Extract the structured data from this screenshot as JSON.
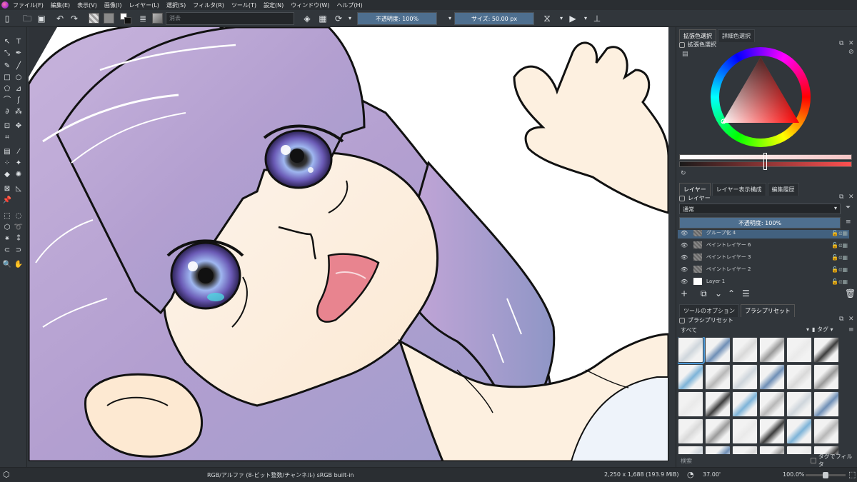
{
  "menu": [
    "ファイル(F)",
    "編集(E)",
    "表示(V)",
    "画像(I)",
    "レイヤー(L)",
    "選択(S)",
    "フィルタ(R)",
    "ツール(T)",
    "設定(N)",
    "ウィンドウ(W)",
    "ヘルプ(H)"
  ],
  "toolbar": {
    "blend_mode": "消去",
    "opacity": "不透明度: 100%",
    "opacity_value": 1.0,
    "size": "サイズ: 50.00 px",
    "size_value": 50.0
  },
  "colors": {
    "foreground": "#ffffff",
    "background": "#8a8a8a",
    "accent": "#4e6f8f",
    "selected_layer": "#42617f"
  },
  "color_docker": {
    "tabs": [
      "拡張色選択",
      "詳細色選択"
    ],
    "title": "拡張色選択"
  },
  "layers_docker": {
    "tabs": [
      "レイヤー",
      "レイヤー表示構成",
      "編集履歴"
    ],
    "title": "レイヤー",
    "blend_mode": "通常",
    "opacity": "不透明度: 100%",
    "layers": [
      {
        "name": "グループ化 4",
        "selected": true
      },
      {
        "name": "ペイントレイヤー 6",
        "selected": false
      },
      {
        "name": "ペイントレイヤー 3",
        "selected": false
      },
      {
        "name": "ペイントレイヤー 2",
        "selected": false
      },
      {
        "name": "Layer 1",
        "selected": false
      }
    ]
  },
  "brush_docker": {
    "tabs": [
      "ツールのオプション",
      "ブラシプリセット"
    ],
    "title": "ブラシプリセット",
    "filter": "すべて",
    "tag_label": "タグ",
    "search_placeholder": "検索",
    "tag_filter_label": "タグでフィルタ"
  },
  "status": {
    "color_info": "RGB/アルファ (8-ビット整数/チャンネル)  sRGB built-in",
    "image_size": "2,250 x 1,688 (193.9 MiB)",
    "rotation": "37.00'",
    "zoom": "100.0%"
  }
}
